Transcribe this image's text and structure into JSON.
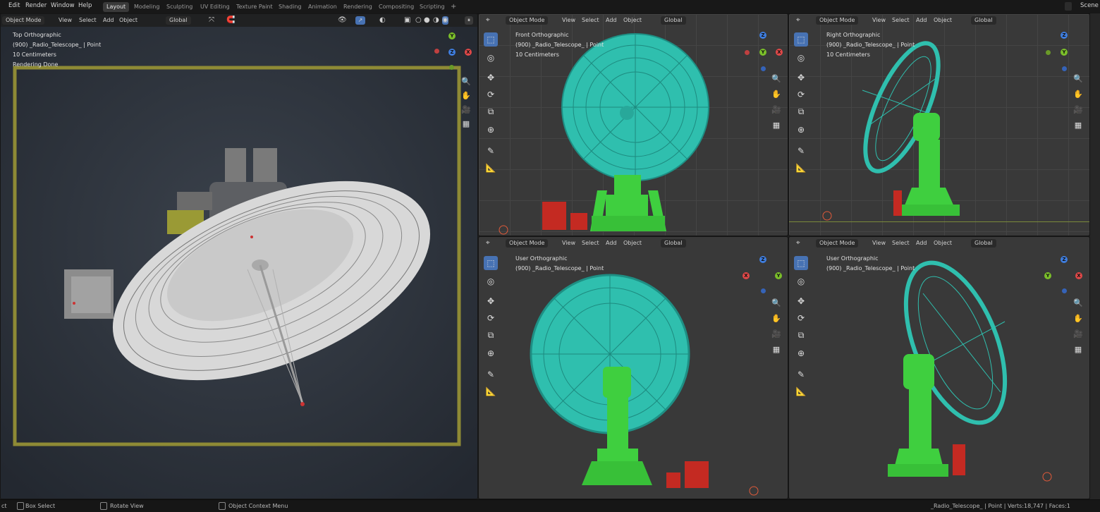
{
  "menu": {
    "items": [
      "Edit",
      "Render",
      "Window",
      "Help"
    ],
    "workspaces": [
      "Layout",
      "Modeling",
      "Sculpting",
      "UV Editing",
      "Texture Paint",
      "Shading",
      "Animation",
      "Rendering",
      "Compositing",
      "Scripting"
    ],
    "add_tab": "+",
    "scene_label": "Scene"
  },
  "viewport_header": {
    "mode": "Object Mode",
    "view": "View",
    "select": "Select",
    "add": "Add",
    "object": "Object",
    "orientation": "Global"
  },
  "viewports": {
    "top": {
      "lines": [
        "Top Orthographic",
        "(900) _Radio_Telescope_ | Point",
        "10 Centimeters",
        "Rendering Done"
      ]
    },
    "front": {
      "lines": [
        "Front Orthographic",
        "(900) _Radio_Telescope_ | Point",
        "10 Centimeters"
      ]
    },
    "right": {
      "lines": [
        "Right Orthographic",
        "(900) _Radio_Telescope_ | Point",
        "10 Centimeters"
      ]
    },
    "user1": {
      "lines": [
        "User Orthographic",
        "(900) _Radio_Telescope_ | Point"
      ]
    },
    "user2": {
      "lines": [
        "User Orthographic",
        "(900) _Radio_Telescope_ | Point"
      ]
    }
  },
  "gizmo": {
    "x": "X",
    "y": "Y",
    "z": "Z"
  },
  "status": {
    "left_fragment": "ct",
    "box_select": "Box Select",
    "rotate_view": "Rotate View",
    "context_menu": "Object Context Menu",
    "stats": "_Radio_Telescope_ | Point | Verts:18,747 | Faces:1"
  },
  "colors": {
    "dish": "#2fbfae",
    "mount": "#3fcf3f",
    "box": "#c42a22",
    "accent": "#4772b3",
    "x_axis": "#e04848",
    "y_axis": "#7bbf2a",
    "z_axis": "#3f7ee0"
  }
}
